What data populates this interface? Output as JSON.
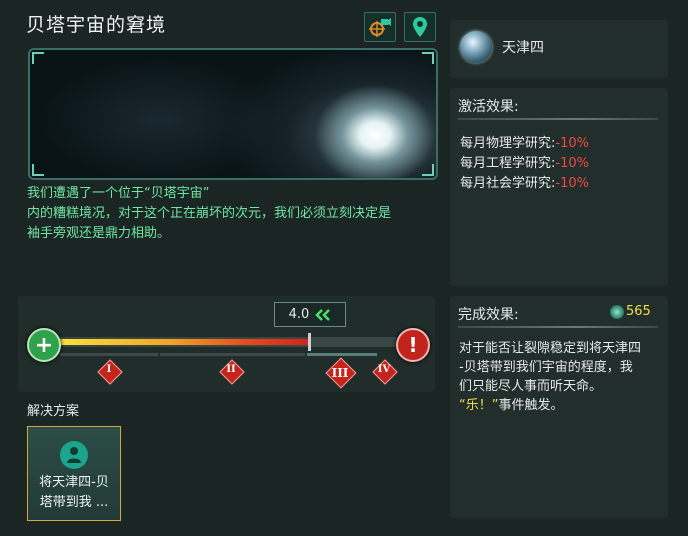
{
  "event": {
    "title": "贝塔宇宙的窘境",
    "description_line1": "我们遭遇了一个位于“贝塔宇宙”",
    "description_line2": "内的糟糕境况，对于这个正在崩坏的次元，我们必须立刻决定是",
    "description_line3": "袖手旁观还是鼎力相助。"
  },
  "toolbar": {
    "camera_icon": "camera-target-icon",
    "location_icon": "location-pin-icon"
  },
  "slider": {
    "value_text": "4.0",
    "progress_percent": 75,
    "tiers": [
      "I",
      "II",
      "III",
      "IV"
    ]
  },
  "solutions": {
    "label": "解决方案",
    "option_line1": "将天津四-贝",
    "option_line2": "塔带到我 ..."
  },
  "planet": {
    "name": "天津四"
  },
  "activation": {
    "title": "激活效果:",
    "effects": [
      {
        "label": "每月物理学研究:",
        "value": "-10%"
      },
      {
        "label": "每月工程学研究:",
        "value": "-10%"
      },
      {
        "label": "每月社会学研究:",
        "value": "-10%"
      }
    ]
  },
  "completion": {
    "title": "完成效果:",
    "reward_value": "565",
    "line1": "对于能否让裂隙稳定到将天津四",
    "line2": "-贝塔带到我们宇宙的程度，我",
    "line3": "们只能尽人事而听天命。",
    "event_name": "“乐！”",
    "event_suffix": "事件触发。"
  },
  "colors": {
    "accent_green": "#6fe8a4",
    "negative_red": "#ef4b3f",
    "highlight_yellow": "#f3dd47",
    "selection_border": "#d6a83a"
  }
}
